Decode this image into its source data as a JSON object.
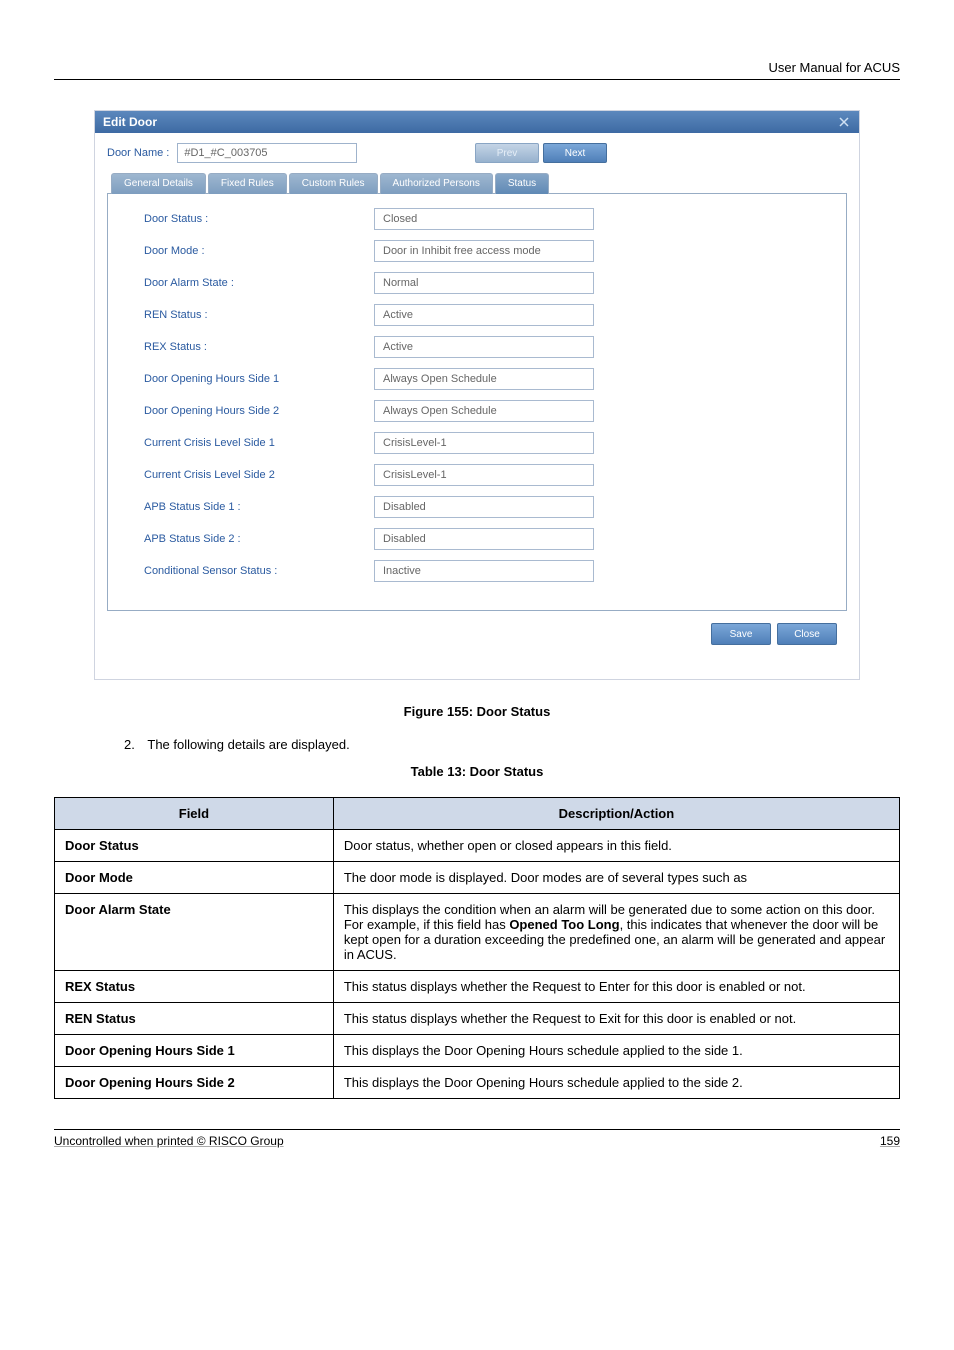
{
  "header": {
    "manual_title": "User Manual for ACUS"
  },
  "dialog": {
    "title": "Edit Door",
    "close_icon": "x",
    "door_name_label": "Door Name :",
    "door_name_value": "#D1_#C_003705",
    "prev_label": "Prev",
    "next_label": "Next",
    "tabs": {
      "general": "General Details",
      "fixed": "Fixed Rules",
      "custom": "Custom Rules",
      "auth": "Authorized Persons",
      "status": "Status"
    },
    "rows": [
      {
        "label": "Door Status :",
        "value": "Closed"
      },
      {
        "label": "Door Mode :",
        "value": "Door in Inhibit free access mode"
      },
      {
        "label": "Door Alarm State :",
        "value": "Normal"
      },
      {
        "label": "REN Status :",
        "value": "Active"
      },
      {
        "label": "REX Status :",
        "value": "Active"
      },
      {
        "label": "Door Opening Hours Side 1",
        "value": "Always Open Schedule"
      },
      {
        "label": "Door Opening Hours Side 2",
        "value": "Always Open Schedule"
      },
      {
        "label": "Current Crisis Level Side 1",
        "value": "CrisisLevel-1"
      },
      {
        "label": "Current Crisis Level Side 2",
        "value": "CrisisLevel-1"
      },
      {
        "label": "APB Status Side 1 :",
        "value": "Disabled"
      },
      {
        "label": "APB Status Side 2 :",
        "value": "Disabled"
      },
      {
        "label": "Conditional Sensor Status :",
        "value": "Inactive"
      }
    ],
    "save_label": "Save",
    "close_label": "Close"
  },
  "figure_caption": "Figure 155: Door Status",
  "list_item": {
    "num": "2.",
    "text": "The following details are displayed."
  },
  "table_caption": "Table 13: Door Status",
  "table": {
    "header_field": "Field",
    "header_desc": "Description/Action",
    "rows": [
      {
        "field": "Door Status",
        "desc": "Door status, whether open or closed appears in this field."
      },
      {
        "field": "Door Mode",
        "desc": "The door mode is displayed. Door modes are of several types such as"
      },
      {
        "field": "Door Alarm State",
        "desc": "This displays the condition when an alarm will be generated due to some action on this door. For example, if this field has Opened Too Long, this indicates that whenever the door will be kept open for a duration exceeding the predefined one, an alarm will be generated and appear in ACUS.",
        "bold_phrase": "Opened Too Long"
      },
      {
        "field": "REX Status",
        "desc": "This status displays whether the Request to Enter for this door is enabled or not."
      },
      {
        "field": "REN Status",
        "desc": "This status displays whether the Request to Exit for this door is enabled or not."
      },
      {
        "field": "Door Opening Hours Side 1",
        "desc": "This displays the Door Opening Hours schedule applied to the side 1."
      },
      {
        "field": "Door Opening Hours Side 2",
        "desc": "This displays the Door Opening Hours schedule applied to the side 2."
      }
    ]
  },
  "footer": {
    "left": "Uncontrolled when printed © RISCO Group",
    "right": "159"
  }
}
